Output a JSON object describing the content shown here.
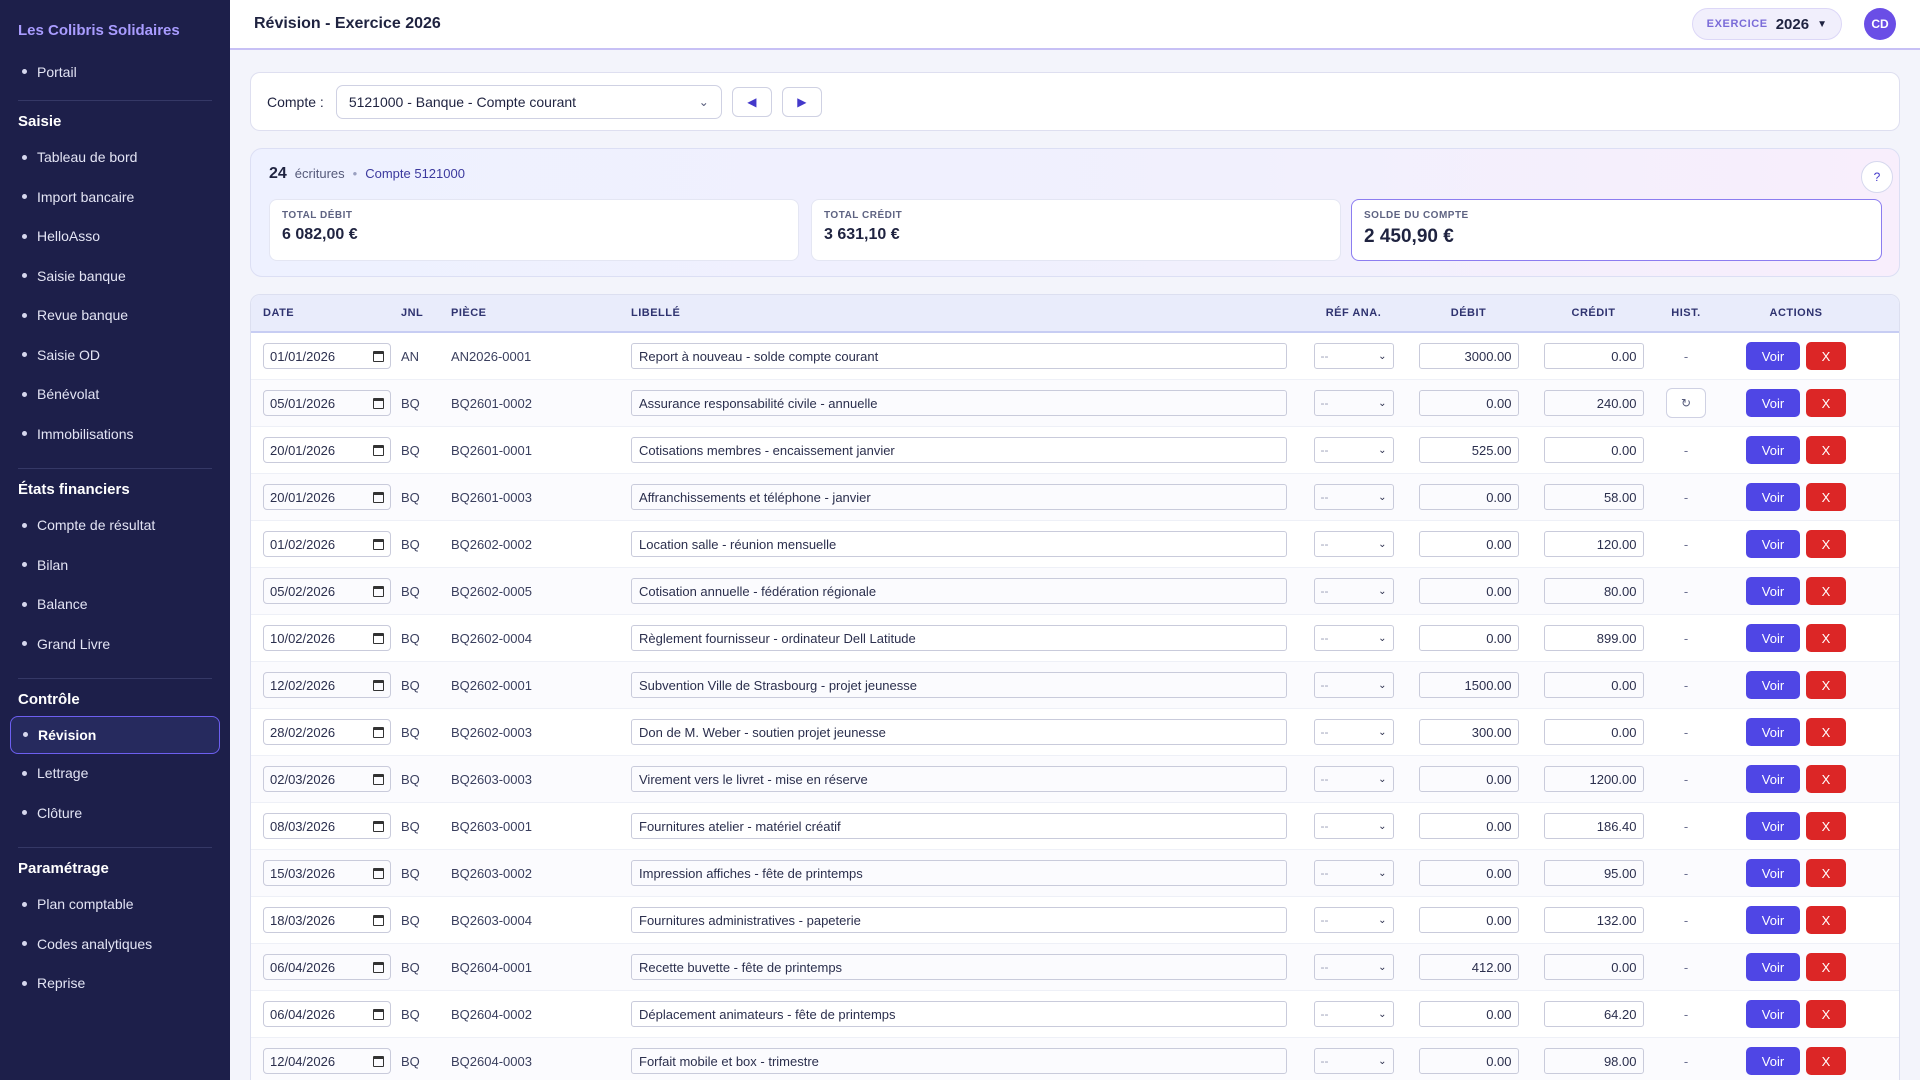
{
  "brand": "Les Colibris Solidaires",
  "sidebar": {
    "top_items": [
      {
        "label": "Portail"
      }
    ],
    "sections": [
      {
        "title": "Saisie",
        "items": [
          {
            "label": "Tableau de bord"
          },
          {
            "label": "Import bancaire"
          },
          {
            "label": "HelloAsso"
          },
          {
            "label": "Saisie banque"
          },
          {
            "label": "Revue banque"
          },
          {
            "label": "Saisie OD"
          },
          {
            "label": "Bénévolat"
          },
          {
            "label": "Immobilisations"
          }
        ]
      },
      {
        "title": "États financiers",
        "items": [
          {
            "label": "Compte de résultat"
          },
          {
            "label": "Bilan"
          },
          {
            "label": "Balance"
          },
          {
            "label": "Grand Livre"
          }
        ]
      },
      {
        "title": "Contrôle",
        "items": [
          {
            "label": "Révision",
            "active": true
          },
          {
            "label": "Lettrage"
          },
          {
            "label": "Clôture"
          }
        ]
      },
      {
        "title": "Paramétrage",
        "items": [
          {
            "label": "Plan comptable"
          },
          {
            "label": "Codes analytiques"
          },
          {
            "label": "Reprise"
          }
        ]
      }
    ]
  },
  "header": {
    "title": "Révision - Exercice 2026",
    "exercise_label": "EXERCICE",
    "exercise_year": "2026",
    "avatar_initials": "CD"
  },
  "account": {
    "label": "Compte :",
    "selected": "5121000 - Banque - Compte courant",
    "prev_glyph": "◀",
    "next_glyph": "▶"
  },
  "summary": {
    "count": "24",
    "count_label": "écritures",
    "separator": "•",
    "account_ref": "Compte 5121000",
    "help": "?",
    "total_debit_label": "TOTAL DÉBIT",
    "total_debit": "6 082,00 €",
    "total_credit_label": "TOTAL CRÉDIT",
    "total_credit": "3 631,10 €",
    "solde_label": "SOLDE DU COMPTE",
    "solde": "2 450,90 €"
  },
  "table": {
    "headers": {
      "date": "DATE",
      "jnl": "JNL",
      "piece": "PIÈCE",
      "libelle": "LIBELLÉ",
      "ref": "RÉF ANA.",
      "debit": "DÉBIT",
      "credit": "CRÉDIT",
      "hist": "HIST.",
      "actions": "ACTIONS"
    },
    "ref_placeholder": "--",
    "hist_dash": "-",
    "hist_icon": "↻",
    "voir_label": "Voir",
    "delete_label": "X",
    "rows": [
      {
        "date": "01/01/2026",
        "jnl": "AN",
        "piece": "AN2026-0001",
        "libelle": "Report à nouveau - solde compte courant",
        "debit": "3000.00",
        "credit": "0.00",
        "hist": false
      },
      {
        "date": "05/01/2026",
        "jnl": "BQ",
        "piece": "BQ2601-0002",
        "libelle": "Assurance responsabilité civile - annuelle",
        "debit": "0.00",
        "credit": "240.00",
        "hist": true
      },
      {
        "date": "20/01/2026",
        "jnl": "BQ",
        "piece": "BQ2601-0001",
        "libelle": "Cotisations membres - encaissement janvier",
        "debit": "525.00",
        "credit": "0.00",
        "hist": false
      },
      {
        "date": "20/01/2026",
        "jnl": "BQ",
        "piece": "BQ2601-0003",
        "libelle": "Affranchissements et téléphone - janvier",
        "debit": "0.00",
        "credit": "58.00",
        "hist": false
      },
      {
        "date": "01/02/2026",
        "jnl": "BQ",
        "piece": "BQ2602-0002",
        "libelle": "Location salle - réunion mensuelle",
        "debit": "0.00",
        "credit": "120.00",
        "hist": false
      },
      {
        "date": "05/02/2026",
        "jnl": "BQ",
        "piece": "BQ2602-0005",
        "libelle": "Cotisation annuelle - fédération régionale",
        "debit": "0.00",
        "credit": "80.00",
        "hist": false
      },
      {
        "date": "10/02/2026",
        "jnl": "BQ",
        "piece": "BQ2602-0004",
        "libelle": "Règlement fournisseur - ordinateur Dell Latitude",
        "debit": "0.00",
        "credit": "899.00",
        "hist": false
      },
      {
        "date": "12/02/2026",
        "jnl": "BQ",
        "piece": "BQ2602-0001",
        "libelle": "Subvention Ville de Strasbourg - projet jeunesse",
        "debit": "1500.00",
        "credit": "0.00",
        "hist": false
      },
      {
        "date": "28/02/2026",
        "jnl": "BQ",
        "piece": "BQ2602-0003",
        "libelle": "Don de M. Weber - soutien projet jeunesse",
        "debit": "300.00",
        "credit": "0.00",
        "hist": false
      },
      {
        "date": "02/03/2026",
        "jnl": "BQ",
        "piece": "BQ2603-0003",
        "libelle": "Virement vers le livret - mise en réserve",
        "debit": "0.00",
        "credit": "1200.00",
        "hist": false
      },
      {
        "date": "08/03/2026",
        "jnl": "BQ",
        "piece": "BQ2603-0001",
        "libelle": "Fournitures atelier - matériel créatif",
        "debit": "0.00",
        "credit": "186.40",
        "hist": false
      },
      {
        "date": "15/03/2026",
        "jnl": "BQ",
        "piece": "BQ2603-0002",
        "libelle": "Impression affiches - fête de printemps",
        "debit": "0.00",
        "credit": "95.00",
        "hist": false
      },
      {
        "date": "18/03/2026",
        "jnl": "BQ",
        "piece": "BQ2603-0004",
        "libelle": "Fournitures administratives - papeterie",
        "debit": "0.00",
        "credit": "132.00",
        "hist": false
      },
      {
        "date": "06/04/2026",
        "jnl": "BQ",
        "piece": "BQ2604-0001",
        "libelle": "Recette buvette - fête de printemps",
        "debit": "412.00",
        "credit": "0.00",
        "hist": false
      },
      {
        "date": "06/04/2026",
        "jnl": "BQ",
        "piece": "BQ2604-0002",
        "libelle": "Déplacement animateurs - fête de printemps",
        "debit": "0.00",
        "credit": "64.20",
        "hist": false
      },
      {
        "date": "12/04/2026",
        "jnl": "BQ",
        "piece": "BQ2604-0003",
        "libelle": "Forfait mobile et box - trimestre",
        "debit": "0.00",
        "credit": "98.00",
        "hist": false
      }
    ]
  }
}
